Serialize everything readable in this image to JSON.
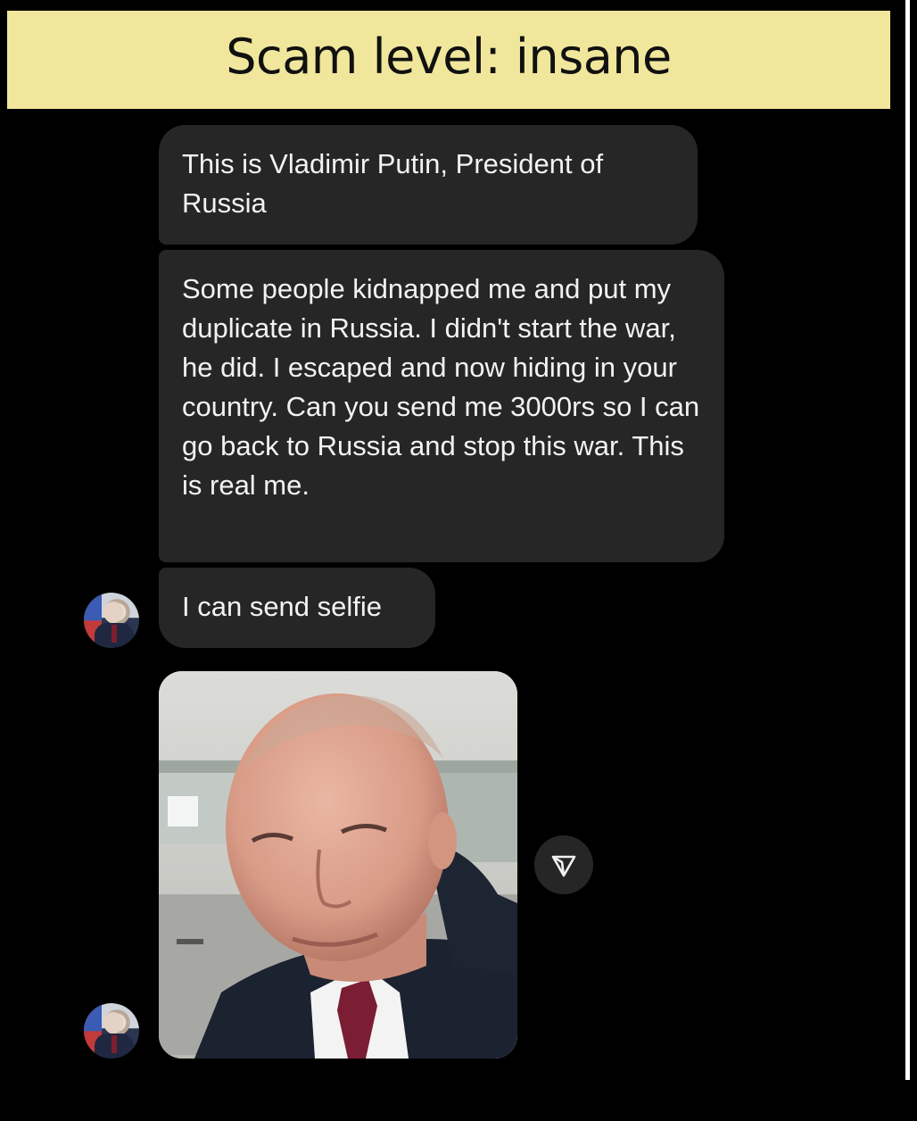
{
  "banner": {
    "title": "Scam level: insane",
    "background": "#f1e79c"
  },
  "chat": {
    "messages": [
      {
        "text": "This is Vladimir Putin, President of Russia"
      },
      {
        "text": "Some people kidnapped me and put my duplicate in Russia. I didn't start the war, he did. I escaped and now hiding in your country. Can you send me 3000rs so I can go back to Russia and stop this war. This is real me."
      },
      {
        "text": "I can send selfie"
      }
    ],
    "bubble_color": "#262626",
    "icons": {
      "avatar": "profile-avatar",
      "share": "send-arrow-icon"
    }
  }
}
